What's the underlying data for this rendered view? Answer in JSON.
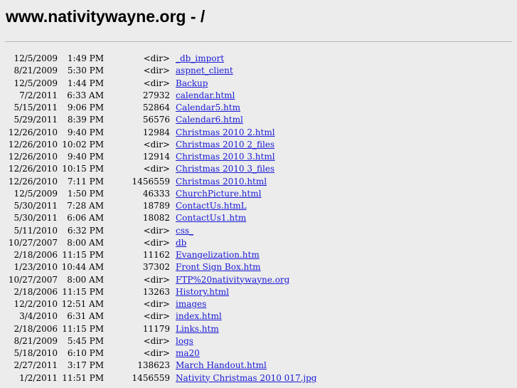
{
  "heading": "www.nativitywayne.org - /",
  "entries": [
    {
      "date": "12/5/2009",
      "time": "1:49 PM",
      "size": "<dir>",
      "name": "_db_import"
    },
    {
      "date": "8/21/2009",
      "time": "5:30 PM",
      "size": "<dir>",
      "name": "aspnet_client"
    },
    {
      "date": "12/5/2009",
      "time": "1:44 PM",
      "size": "<dir>",
      "name": "Backup"
    },
    {
      "date": "7/2/2011",
      "time": "6:33 AM",
      "size": "27932",
      "name": "calendar.html"
    },
    {
      "date": "5/15/2011",
      "time": "9:06 PM",
      "size": "52864",
      "name": "Calendar5.htm"
    },
    {
      "date": "5/29/2011",
      "time": "8:39 PM",
      "size": "56576",
      "name": "Calendar6.html"
    },
    {
      "date": "12/26/2010",
      "time": "9:40 PM",
      "size": "12984",
      "name": "Christmas 2010 2.html"
    },
    {
      "date": "12/26/2010",
      "time": "10:02 PM",
      "size": "<dir>",
      "name": "Christmas 2010 2_files"
    },
    {
      "date": "12/26/2010",
      "time": "9:40 PM",
      "size": "12914",
      "name": "Christmas 2010 3.html"
    },
    {
      "date": "12/26/2010",
      "time": "10:15 PM",
      "size": "<dir>",
      "name": "Christmas 2010 3_files"
    },
    {
      "date": "12/26/2010",
      "time": "7:11 PM",
      "size": "1456559",
      "name": "Christmas 2010.html"
    },
    {
      "date": "12/5/2009",
      "time": "1:50 PM",
      "size": "46333",
      "name": "ChurchPicture.html"
    },
    {
      "date": "5/30/2011",
      "time": "7:28 AM",
      "size": "18789",
      "name": "ContactUs.htmL"
    },
    {
      "date": "5/30/2011",
      "time": "6:06 AM",
      "size": "18082",
      "name": "ContactUs1.htm"
    },
    {
      "date": "5/11/2010",
      "time": "6:32 PM",
      "size": "<dir>",
      "name": "css_"
    },
    {
      "date": "10/27/2007",
      "time": "8:00 AM",
      "size": "<dir>",
      "name": "db"
    },
    {
      "date": "2/18/2006",
      "time": "11:15 PM",
      "size": "11162",
      "name": "Evangelization.htm"
    },
    {
      "date": "1/23/2010",
      "time": "10:44 AM",
      "size": "37302",
      "name": "Front Sign Box.htm"
    },
    {
      "date": "10/27/2007",
      "time": "8:00 AM",
      "size": "<dir>",
      "name": "FTP%20nativitywayne.org"
    },
    {
      "date": "2/18/2006",
      "time": "11:15 PM",
      "size": "13263",
      "name": "History.html"
    },
    {
      "date": "12/2/2010",
      "time": "12:51 AM",
      "size": "<dir>",
      "name": "images"
    },
    {
      "date": "3/4/2010",
      "time": "6:31 AM",
      "size": "<dir>",
      "name": "index.html"
    },
    {
      "date": "2/18/2006",
      "time": "11:15 PM",
      "size": "11179",
      "name": "Links.htm"
    },
    {
      "date": "8/21/2009",
      "time": "5:45 PM",
      "size": "<dir>",
      "name": "logs"
    },
    {
      "date": "5/18/2010",
      "time": "6:10 PM",
      "size": "<dir>",
      "name": "ma20"
    },
    {
      "date": "2/27/2011",
      "time": "3:17 PM",
      "size": "138623",
      "name": "March Handout.html"
    },
    {
      "date": "1/2/2011",
      "time": "11:51 PM",
      "size": "1456559",
      "name": "Nativity Christmas 2010 017.jpg"
    }
  ]
}
